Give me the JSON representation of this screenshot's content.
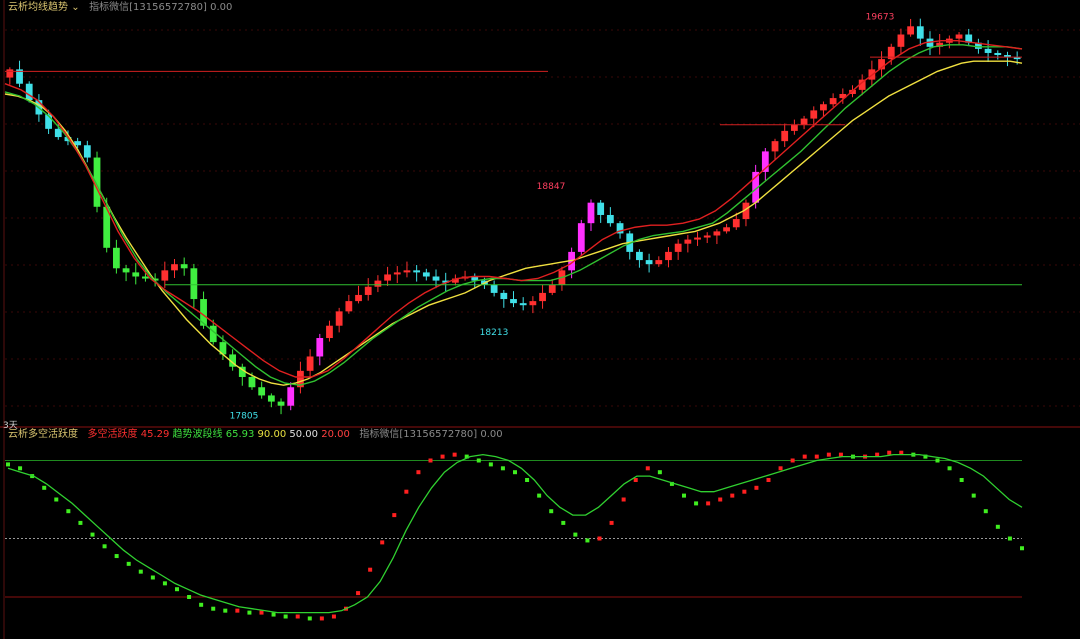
{
  "top_panel": {
    "indicator_name": "云析均线趋势",
    "dropdown_icon": "chevron-down-icon",
    "note": "指标微信[13156572780] 0.00",
    "days_label": "3天"
  },
  "bottom_panel": {
    "indicator_name": "云析多空活跃度",
    "labels": [
      {
        "text": "多空活跃度 45.29",
        "color": "#ff3030"
      },
      {
        "text": "趋势波段线 65.93",
        "color": "#3fe03f"
      },
      {
        "text": "90.00",
        "color": "#e8e040"
      },
      {
        "text": "50.00",
        "color": "#e0e0e0"
      },
      {
        "text": "20.00",
        "color": "#ff4040"
      }
    ],
    "note": "指标微信[13156572780] 0.00"
  },
  "colors": {
    "background": "#000000",
    "up_candle": "#ff3030",
    "down_candle": "#40e0e8",
    "strong_up_candle": "#ff30ff",
    "weak_down_candle": "#40ee40",
    "ma_yellow": "#f0e040",
    "ma_green": "#30c030",
    "ma_red": "#e02020"
  },
  "chart_data": [
    {
      "type": "candlestick",
      "panel": "price",
      "title": "",
      "ylim": [
        17750,
        19720
      ],
      "annotations": [
        {
          "text": "17805",
          "value": 17805,
          "kind": "low"
        },
        {
          "text": "18213",
          "value": 18213,
          "kind": "low"
        },
        {
          "text": "18847",
          "value": 18847,
          "kind": "high"
        },
        {
          "text": "19673",
          "value": 19673,
          "kind": "high"
        }
      ],
      "close": [
        19450,
        19380,
        19300,
        19230,
        19160,
        19120,
        19100,
        19080,
        19020,
        18780,
        18580,
        18480,
        18460,
        18440,
        18430,
        18420,
        18470,
        18500,
        18480,
        18330,
        18200,
        18120,
        18060,
        18000,
        17950,
        17900,
        17860,
        17830,
        17810,
        17900,
        17980,
        18050,
        18140,
        18200,
        18270,
        18320,
        18350,
        18390,
        18420,
        18450,
        18460,
        18470,
        18460,
        18440,
        18420,
        18410,
        18430,
        18440,
        18420,
        18400,
        18360,
        18330,
        18310,
        18300,
        18320,
        18360,
        18400,
        18470,
        18560,
        18700,
        18800,
        18740,
        18700,
        18650,
        18560,
        18520,
        18500,
        18520,
        18560,
        18600,
        18620,
        18630,
        18640,
        18660,
        18680,
        18720,
        18800,
        18950,
        19050,
        19100,
        19150,
        19180,
        19210,
        19250,
        19280,
        19310,
        19330,
        19350,
        19400,
        19450,
        19500,
        19560,
        19620,
        19660,
        19600,
        19560,
        19580,
        19600,
        19620,
        19580,
        19550,
        19530,
        19520,
        19510,
        19500
      ],
      "series": [
        {
          "name": "MA-yellow",
          "values": [
            19330,
            19320,
            19300,
            19270,
            19220,
            19150,
            19060,
            18950,
            18840,
            18730,
            18630,
            18540,
            18450,
            18370,
            18300,
            18230,
            18170,
            18110,
            18060,
            18010,
            17970,
            17940,
            17920,
            17910,
            17920,
            17940,
            17970,
            18010,
            18050,
            18090,
            18130,
            18170,
            18210,
            18240,
            18270,
            18300,
            18320,
            18340,
            18360,
            18390,
            18420,
            18440,
            18460,
            18480,
            18490,
            18500,
            18510,
            18520,
            18540,
            18560,
            18580,
            18600,
            18610,
            18620,
            18630,
            18640,
            18650,
            18660,
            18680,
            18700,
            18730,
            18760,
            18800,
            18850,
            18900,
            18950,
            19000,
            19050,
            19100,
            19150,
            19200,
            19240,
            19280,
            19320,
            19350,
            19380,
            19410,
            19440,
            19460,
            19480,
            19490,
            19490,
            19490,
            19490,
            19480
          ]
        },
        {
          "name": "MA-green",
          "values": [
            19340,
            19320,
            19280,
            19220,
            19140,
            19040,
            18920,
            18780,
            18640,
            18520,
            18430,
            18360,
            18300,
            18240,
            18180,
            18120,
            18060,
            18000,
            17950,
            17920,
            17910,
            17930,
            17970,
            18020,
            18080,
            18140,
            18190,
            18240,
            18290,
            18330,
            18370,
            18400,
            18420,
            18430,
            18430,
            18420,
            18420,
            18420,
            18440,
            18470,
            18510,
            18550,
            18590,
            18620,
            18640,
            18650,
            18660,
            18680,
            18700,
            18750,
            18810,
            18870,
            18930,
            18990,
            19050,
            19120,
            19190,
            19260,
            19320,
            19380,
            19440,
            19490,
            19530,
            19560,
            19570,
            19570,
            19560,
            19560,
            19560,
            19550
          ]
        },
        {
          "name": "MA-red",
          "values": [
            19380,
            19350,
            19300,
            19220,
            19110,
            18980,
            18820,
            18660,
            18530,
            18430,
            18370,
            18320,
            18270,
            18210,
            18150,
            18090,
            18030,
            17980,
            17950,
            17950,
            17980,
            18040,
            18110,
            18180,
            18250,
            18310,
            18360,
            18400,
            18430,
            18440,
            18440,
            18430,
            18420,
            18430,
            18460,
            18500,
            18560,
            18620,
            18660,
            18680,
            18690,
            18690,
            18700,
            18720,
            18760,
            18820,
            18890,
            18960,
            19030,
            19100,
            19170,
            19240,
            19310,
            19380,
            19440,
            19500,
            19550,
            19580,
            19590,
            19590,
            19580,
            19570,
            19560,
            19550
          ]
        }
      ]
    },
    {
      "type": "line",
      "panel": "oscillator",
      "ylim": [
        0,
        100
      ],
      "reference_lines": [
        90,
        50,
        20
      ],
      "series": [
        {
          "name": "多空活跃度",
          "values": [
            88,
            86,
            82,
            76,
            70,
            64,
            58,
            52,
            46,
            41,
            37,
            33,
            30,
            27,
            24,
            20,
            16,
            14,
            13,
            13,
            12,
            12,
            11,
            10,
            10,
            9,
            9,
            10,
            14,
            22,
            34,
            48,
            62,
            74,
            84,
            90,
            92,
            93,
            92,
            90,
            88,
            86,
            84,
            80,
            72,
            64,
            58,
            52,
            49,
            50,
            58,
            70,
            80,
            86,
            84,
            78,
            72,
            68,
            68,
            70,
            72,
            74,
            76,
            80,
            86,
            90,
            92,
            92,
            93,
            93,
            92,
            92,
            93,
            94,
            94,
            93,
            92,
            90,
            86,
            80,
            72,
            64,
            56,
            50,
            45
          ]
        },
        {
          "name": "趋势波段线",
          "values": [
            86,
            84,
            82,
            78,
            73,
            68,
            62,
            56,
            50,
            44,
            39,
            35,
            31,
            27,
            24,
            21,
            19,
            17,
            15,
            14,
            13,
            12,
            12,
            12,
            12,
            12,
            13,
            16,
            20,
            28,
            40,
            54,
            66,
            76,
            84,
            89,
            92,
            93,
            92,
            90,
            86,
            80,
            72,
            66,
            62,
            62,
            66,
            72,
            78,
            82,
            82,
            80,
            78,
            76,
            74,
            74,
            76,
            78,
            80,
            82,
            84,
            86,
            88,
            90,
            91,
            92,
            92,
            92,
            92,
            93,
            93,
            93,
            92,
            91,
            89,
            86,
            82,
            76,
            70,
            66
          ]
        }
      ]
    }
  ]
}
